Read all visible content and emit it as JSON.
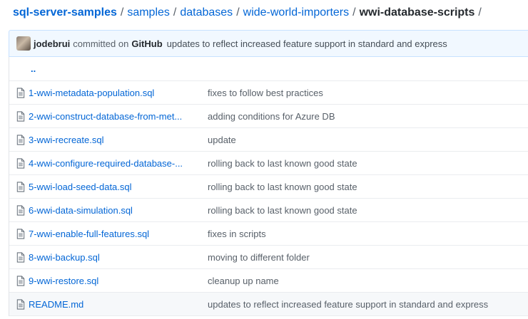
{
  "breadcrumb": {
    "repo": "sql-server-samples",
    "parts": [
      "samples",
      "databases",
      "wide-world-importers"
    ],
    "current": "wwi-database-scripts",
    "separator": "/"
  },
  "commit": {
    "author": "jodebrui",
    "action": "committed on",
    "platform": "GitHub",
    "message": "updates to reflect increased feature support in standard and express"
  },
  "parent_dir": "..",
  "files": [
    {
      "name": "1-wwi-metadata-population.sql",
      "message": "fixes to follow best practices",
      "icon": "file-icon"
    },
    {
      "name": "2-wwi-construct-database-from-met...",
      "message": "adding conditions for Azure DB",
      "icon": "file-icon"
    },
    {
      "name": "3-wwi-recreate.sql",
      "message": "update",
      "icon": "file-icon"
    },
    {
      "name": "4-wwi-configure-required-database-...",
      "message": "rolling back to last known good state",
      "icon": "file-icon"
    },
    {
      "name": "5-wwi-load-seed-data.sql",
      "message": "rolling back to last known good state",
      "icon": "file-icon"
    },
    {
      "name": "6-wwi-data-simulation.sql",
      "message": "rolling back to last known good state",
      "icon": "file-icon"
    },
    {
      "name": "7-wwi-enable-full-features.sql",
      "message": "fixes in scripts",
      "icon": "file-icon"
    },
    {
      "name": "8-wwi-backup.sql",
      "message": "moving to different folder",
      "icon": "file-icon"
    },
    {
      "name": "9-wwi-restore.sql",
      "message": "cleanup up name",
      "icon": "file-icon"
    },
    {
      "name": "README.md",
      "message": "updates to reflect increased feature support in standard and express",
      "icon": "file-icon"
    }
  ],
  "colors": {
    "link": "#0366d6",
    "commit_bar_bg": "#f1f8ff",
    "commit_bar_border": "#c8e1ff",
    "highlight_row": "#f6f8fa"
  }
}
